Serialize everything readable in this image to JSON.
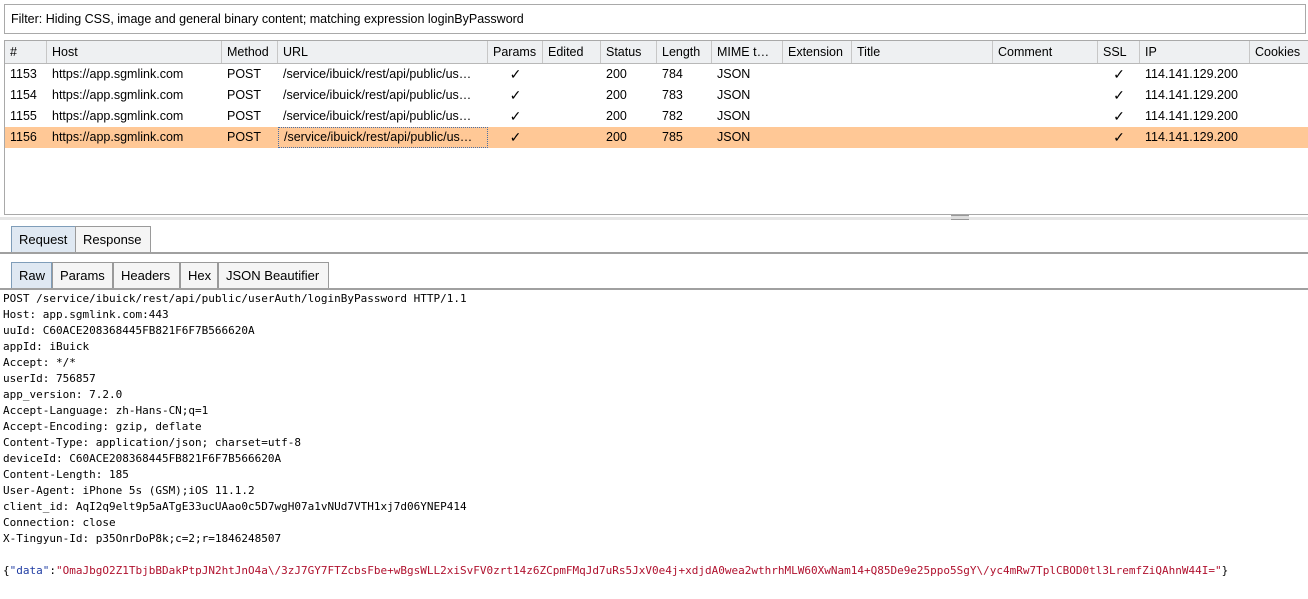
{
  "filter": {
    "text": "Filter: Hiding CSS, image and general binary content;  matching expression loginByPassword"
  },
  "table": {
    "columns": [
      "#",
      "Host",
      "Method",
      "URL",
      "Params",
      "Edited",
      "Status",
      "Length",
      "MIME t…",
      "Extension",
      "Title",
      "Comment",
      "SSL",
      "IP",
      "Cookies"
    ],
    "rows": [
      {
        "num": "1153",
        "host": "https://app.sgmlink.com",
        "method": "POST",
        "url": "/service/ibuick/rest/api/public/us…",
        "params": "✓",
        "edited": "",
        "status": "200",
        "length": "784",
        "mime": "JSON",
        "extension": "",
        "title": "",
        "comment": "",
        "ssl": "✓",
        "ip": "114.141.129.200",
        "cookies": ""
      },
      {
        "num": "1154",
        "host": "https://app.sgmlink.com",
        "method": "POST",
        "url": "/service/ibuick/rest/api/public/us…",
        "params": "✓",
        "edited": "",
        "status": "200",
        "length": "783",
        "mime": "JSON",
        "extension": "",
        "title": "",
        "comment": "",
        "ssl": "✓",
        "ip": "114.141.129.200",
        "cookies": ""
      },
      {
        "num": "1155",
        "host": "https://app.sgmlink.com",
        "method": "POST",
        "url": "/service/ibuick/rest/api/public/us…",
        "params": "✓",
        "edited": "",
        "status": "200",
        "length": "782",
        "mime": "JSON",
        "extension": "",
        "title": "",
        "comment": "",
        "ssl": "✓",
        "ip": "114.141.129.200",
        "cookies": ""
      },
      {
        "num": "1156",
        "host": "https://app.sgmlink.com",
        "method": "POST",
        "url": "/service/ibuick/rest/api/public/us…",
        "params": "✓",
        "edited": "",
        "status": "200",
        "length": "785",
        "mime": "JSON",
        "extension": "",
        "title": "",
        "comment": "",
        "ssl": "✓",
        "ip": "114.141.129.200",
        "cookies": "",
        "selected": true
      }
    ]
  },
  "colors": {
    "selected_row": "#ffc896",
    "json_key": "#1f3ca3",
    "json_string": "#b0112e"
  },
  "tabs_main": [
    {
      "label": "Request",
      "active": true
    },
    {
      "label": "Response",
      "active": false
    }
  ],
  "tabs_sub": [
    {
      "label": "Raw",
      "active": true
    },
    {
      "label": "Params",
      "active": false
    },
    {
      "label": "Headers",
      "active": false
    },
    {
      "label": "Hex",
      "active": false
    },
    {
      "label": "JSON Beautifier",
      "active": false
    }
  ],
  "request": {
    "lines": [
      "POST /service/ibuick/rest/api/public/userAuth/loginByPassword HTTP/1.1",
      "Host: app.sgmlink.com:443",
      "uuId: C60ACE208368445FB821F6F7B566620A",
      "appId: iBuick",
      "Accept: */*",
      "userId: 756857",
      "app_version: 7.2.0",
      "Accept-Language: zh-Hans-CN;q=1",
      "Accept-Encoding: gzip, deflate",
      "Content-Type: application/json; charset=utf-8",
      "deviceId: C60ACE208368445FB821F6F7B566620A",
      "Content-Length: 185",
      "User-Agent: iPhone 5s (GSM);iOS 11.1.2",
      "client_id: AqI2q9elt9p5aATgE33ucUAao0c5D7wgH07a1vNUd7VTH1xj7d06YNEP414",
      "Connection: close",
      "X-Tingyun-Id: p35OnrDoP8k;c=2;r=1846248507"
    ],
    "body": {
      "open_brace": "{",
      "key": "\"data\"",
      "colon": ":",
      "value": "\"OmaJbgO2Z1TbjbBDakPtpJN2htJnO4a\\/3zJ7GY7FTZcbsFbe+wBgsWLL2xiSvFV0zrt14z6ZCpmFMqJd7uRs5JxV0e4j+xdjdA0wea2wthrhMLW60XwNam14+Q85De9e25ppo5SgY\\/yc4mRw7TplCBOD0tl3LremfZiQAhnW44I=\"",
      "close_brace": "}"
    }
  }
}
